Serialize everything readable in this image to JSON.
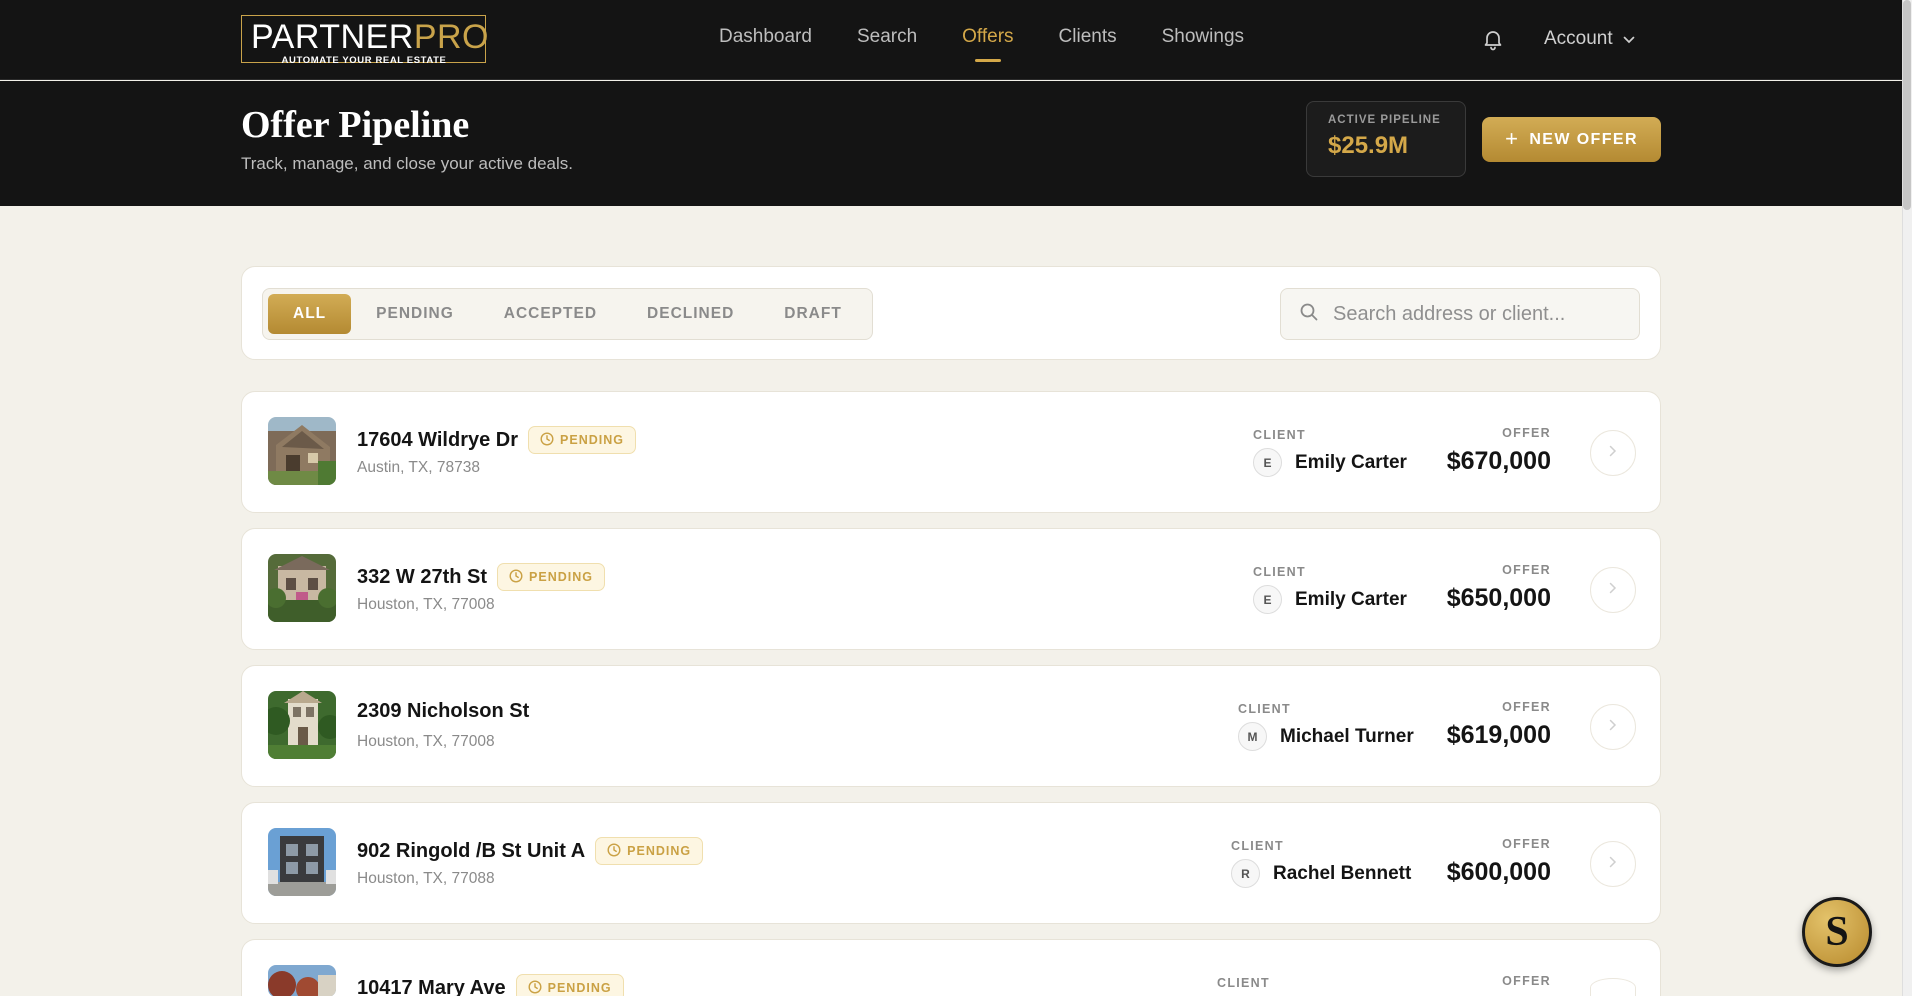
{
  "brand": {
    "name_part1": "PARTNER",
    "name_part2": "PRO",
    "tagline": "AUTOMATE YOUR REAL ESTATE"
  },
  "nav": [
    {
      "label": "Dashboard",
      "active": false
    },
    {
      "label": "Search",
      "active": false
    },
    {
      "label": "Offers",
      "active": true
    },
    {
      "label": "Clients",
      "active": false
    },
    {
      "label": "Showings",
      "active": false
    }
  ],
  "account_label": "Account",
  "header": {
    "title": "Offer Pipeline",
    "subtitle": "Track, manage, and close your active deals.",
    "pipeline_label": "ACTIVE PIPELINE",
    "pipeline_value": "$25.9M",
    "new_offer_label": "NEW OFFER"
  },
  "filters": {
    "tabs": [
      "ALL",
      "PENDING",
      "ACCEPTED",
      "DECLINED",
      "DRAFT"
    ],
    "active": "ALL",
    "search_placeholder": "Search address or client..."
  },
  "labels": {
    "client": "CLIENT",
    "offer": "OFFER"
  },
  "offers": [
    {
      "address": "17604 Wildrye Dr",
      "status": "PENDING",
      "city": "Austin, TX, 78738",
      "client_initial": "E",
      "client_name": "Emily Carter",
      "amount": "$670,000"
    },
    {
      "address": "332 W 27th St",
      "status": "PENDING",
      "city": "Houston, TX, 77008",
      "client_initial": "E",
      "client_name": "Emily Carter",
      "amount": "$650,000"
    },
    {
      "address": "2309 Nicholson St",
      "status": "",
      "city": "Houston, TX, 77008",
      "client_initial": "M",
      "client_name": "Michael Turner",
      "amount": "$619,000"
    },
    {
      "address": "902 Ringold /B St Unit A",
      "status": "PENDING",
      "city": "Houston, TX, 77088",
      "client_initial": "R",
      "client_name": "Rachel Bennett",
      "amount": "$600,000"
    },
    {
      "address": "10417 Mary Ave",
      "status": "PENDING",
      "city": "",
      "client_initial": "",
      "client_name": "",
      "amount": ""
    }
  ],
  "fab_letter": "S",
  "colors": {
    "accent": "#d4a849",
    "dark": "#141414",
    "page_bg": "#f3f1ea"
  },
  "icons": [
    "bell-icon",
    "chevron-down-icon",
    "plus-icon",
    "search-icon",
    "clock-icon",
    "chevron-right-icon"
  ]
}
